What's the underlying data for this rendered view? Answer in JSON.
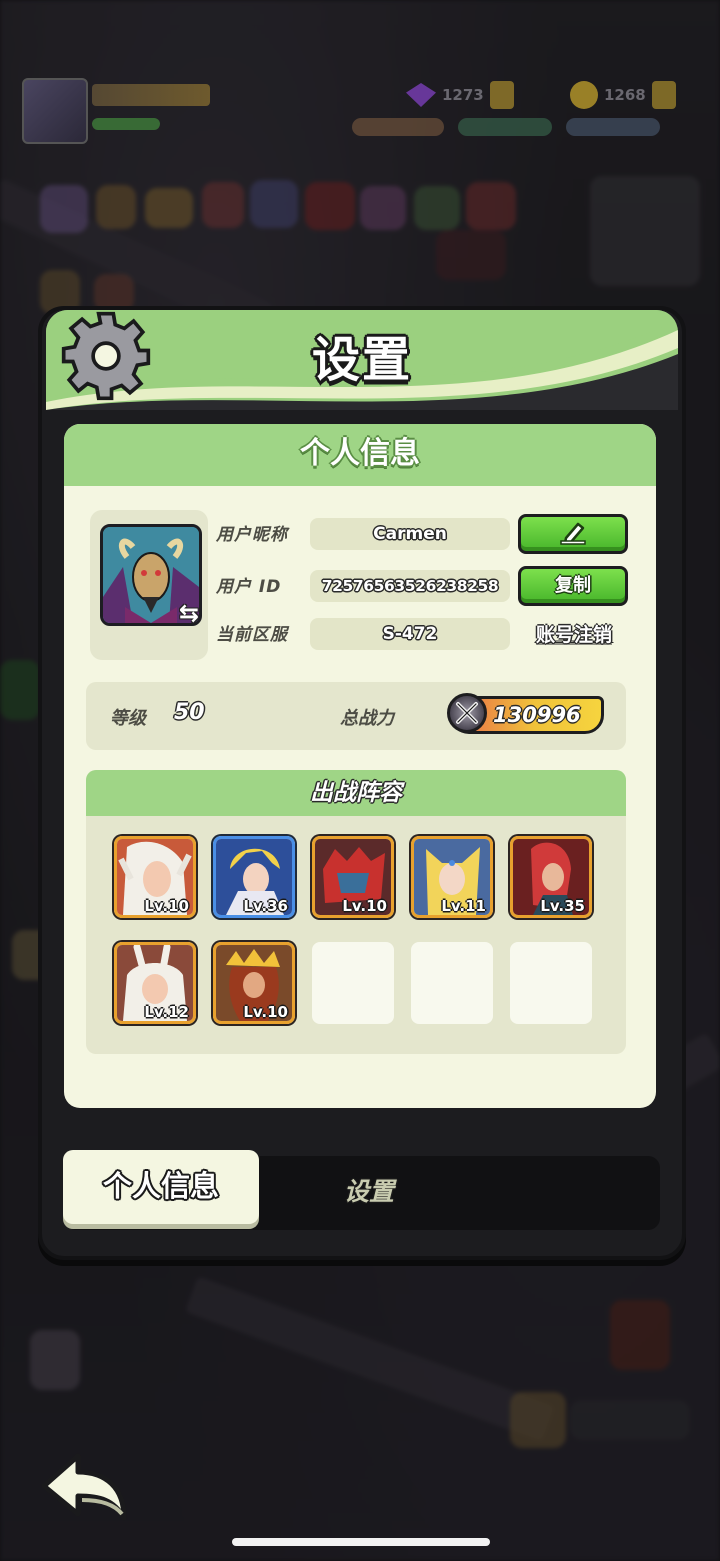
{
  "hud": {
    "gems": "1273",
    "coins": "1268"
  },
  "panel": {
    "title": "设置",
    "card_title": "个人信息",
    "nickname_label": "用户昵称",
    "nickname": "Carmen",
    "id_label": "用户 ID",
    "user_id": "72576563526238258",
    "copy_label": "复制",
    "server_label": "当前区服",
    "server": "S-472",
    "account_cancel_label": "账号注销",
    "level_label": "等级",
    "level": "50",
    "power_label": "总战力",
    "power": "130996",
    "lineup_title": "出战阵容",
    "heroes": [
      {
        "level": "Lv.10",
        "frame": "gold"
      },
      {
        "level": "Lv.36",
        "frame": "blue"
      },
      {
        "level": "Lv.10",
        "frame": "gold"
      },
      {
        "level": "Lv.11",
        "frame": "gold"
      },
      {
        "level": "Lv.35",
        "frame": "gold"
      },
      {
        "level": "Lv.12",
        "frame": "gold"
      },
      {
        "level": "Lv.10",
        "frame": "gold"
      }
    ]
  },
  "tabs": {
    "active": "个人信息",
    "inactive": "设置"
  },
  "icons": {
    "gear": "gear-icon",
    "edit": "pencil-edit-icon",
    "swap": "swap-arrows-icon",
    "power": "crossed-swords-icon",
    "back": "back-arrow-icon"
  },
  "colors": {
    "header_green": "#9bd07f",
    "button_green": "#47b52a",
    "card_bg": "#f4f6e1",
    "hero_frame_gold": "#e8a12e",
    "hero_frame_blue": "#4a8fe6"
  }
}
